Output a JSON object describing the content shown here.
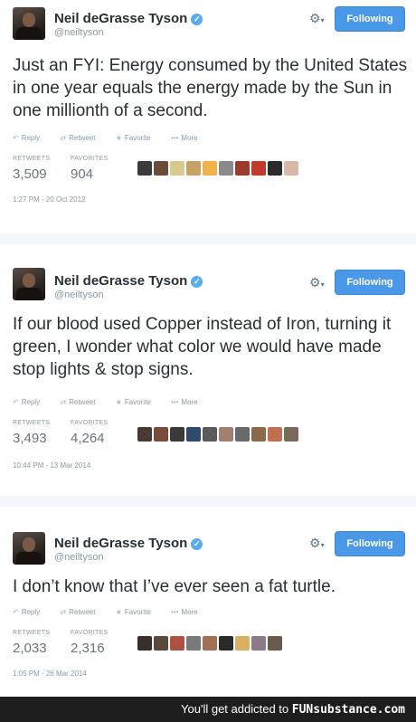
{
  "tweets": [
    {
      "name": "Neil deGrasse Tyson",
      "handle": "@neiltyson",
      "follow_label": "Following",
      "text": "Just an FYI: Energy consumed by the United States in one year equals the energy made by the Sun in one millionth of a second.",
      "actions": {
        "reply": "Reply",
        "retweet": "Retweet",
        "favorite": "Favorite",
        "more": "More"
      },
      "retweets_label": "RETWEETS",
      "retweets": "3,509",
      "favorites_label": "FAVORITES",
      "favorites": "904",
      "timestamp": "1:27 PM - 20 Oct 2012",
      "favoriter_colors": [
        "#3a3a3a",
        "#6b4a3a",
        "#d9c98a",
        "#c9a063",
        "#f0b24a",
        "#8a8a8a",
        "#9b3b2b",
        "#c23a2a",
        "#2a2a2a",
        "#d8b8a8"
      ]
    },
    {
      "name": "Neil deGrasse Tyson",
      "handle": "@neiltyson",
      "follow_label": "Following",
      "text": "If our blood used Copper instead of Iron, turning it green, I wonder what color we would have made stop lights & stop signs.",
      "actions": {
        "reply": "Reply",
        "retweet": "Retweet",
        "favorite": "Favorite",
        "more": "More"
      },
      "retweets_label": "RETWEETS",
      "retweets": "3,493",
      "favorites_label": "FAVORITES",
      "favorites": "4,264",
      "timestamp": "10:44 PM - 13 Mar 2014",
      "favoriter_colors": [
        "#4a3a32",
        "#7a4a3a",
        "#3a3a3a",
        "#2f4a6a",
        "#5a5a5a",
        "#a08070",
        "#6a6a6a",
        "#8a6a4a",
        "#c07050",
        "#7a6a5a"
      ]
    },
    {
      "name": "Neil deGrasse Tyson",
      "handle": "@neiltyson",
      "follow_label": "Following",
      "text": "I don’t know that I’ve ever seen a fat turtle.",
      "actions": {
        "reply": "Reply",
        "retweet": "Retweet",
        "favorite": "Favorite",
        "more": "More"
      },
      "retweets_label": "RETWEETS",
      "retweets": "2,033",
      "favorites_label": "FAVORITES",
      "favorites": "2,316",
      "timestamp": "1:05 PM - 26 Mar 2014",
      "favoriter_colors": [
        "#3a2e2a",
        "#5a4a3a",
        "#b05040",
        "#7a7a7a",
        "#a07050",
        "#2a2a2a",
        "#d8b060",
        "#8a7a8a",
        "#6a5a4a"
      ]
    }
  ],
  "footer": {
    "prefix": "You'll get addicted to",
    "brand": "FUNsubstance.com"
  },
  "colors": {
    "follow_button": "#4a99e9",
    "verified": "#55acee",
    "footer_bg": "#1e1e1e"
  },
  "icons": [
    "gear-icon",
    "reply-icon",
    "retweet-icon",
    "favorite-star-icon",
    "more-dots-icon",
    "verified-badge-icon"
  ]
}
